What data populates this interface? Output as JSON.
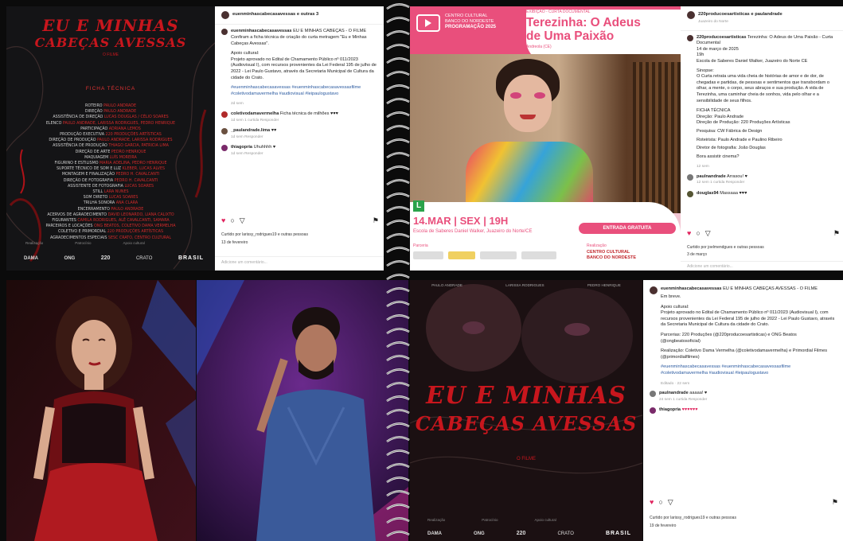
{
  "poster_tl": {
    "title_line1": "EU E MINHAS",
    "title_line2": "CABEÇAS AVESSAS",
    "subtitle": "O FILME",
    "section": "FICHA TÉCNICA",
    "credits": [
      {
        "role": "ROTEIRO",
        "name": "PAULO ANDRADE"
      },
      {
        "role": "DIREÇÃO",
        "name": "PAULO ANDRADE"
      },
      {
        "role": "ASSISTÊNCIA DE DIREÇÃO",
        "name": "LUCAS DOUGLAS / CÉLIO SOARES"
      },
      {
        "role": "ELENCO",
        "name": "PAULO ANDRADE, LARISSA RODRIGUES, PEDRO HENRIQUE"
      },
      {
        "role": "PARTICIPAÇÃO",
        "name": "ADRIANA LEMOS"
      },
      {
        "role": "PRODUÇÃO EXECUTIVA",
        "name": "220 PRODUÇÕES ARTÍSTICAS"
      },
      {
        "role": "DIREÇÃO DE PRODUÇÃO",
        "name": "PAULO ANDRADE, LARISSA RODRIGUES"
      },
      {
        "role": "ASSISTÊNCIA DE PRODUÇÃO",
        "name": "THIAGO GARCIA, PATRICIA LIMA"
      },
      {
        "role": "DIREÇÃO DE ARTE",
        "name": "PEDRO HENRIQUE"
      },
      {
        "role": "MAQUIAGEM",
        "name": "LUÍS MOREIRA"
      },
      {
        "role": "FIGURINO E ESTILISMO",
        "name": "MARIA ADELINA, PEDRO HENRIQUE"
      },
      {
        "role": "SUPORTE TÉCNICO DE SOM E LUZ",
        "name": "KLEBER, LUCAS ALVES"
      },
      {
        "role": "MONTAGEM E FINALIZAÇÃO",
        "name": "PEDRO H. CAVALCANTI"
      },
      {
        "role": "DIREÇÃO DE FOTOGRAFIA",
        "name": "PEDRO H. CAVALCANTI"
      },
      {
        "role": "ASSISTENTE DE FOTOGRAFIA",
        "name": "LUCAS SOARES"
      },
      {
        "role": "STILL",
        "name": "LARA NUNES"
      },
      {
        "role": "SOM DIRETO",
        "name": "LUCAS SOARES"
      },
      {
        "role": "TRILHA SONORA",
        "name": "ANA CLARA"
      },
      {
        "role": "ENCERRAMENTO",
        "name": "PAULO ANDRADE"
      },
      {
        "role": "ACERVOS DE AGRADECIMENTO",
        "name": "DAVID LEONARDO, LIANA CALIXTO"
      },
      {
        "role": "FIGURANTES",
        "name": "CAMILA RODRIGUES, ALÊ CAVALCANTI, SAMARA"
      },
      {
        "role": "PARCEIROS E LOCAÇÕES",
        "name": "ONG BEATOS, COLETIVO DAMA VERMELHA"
      },
      {
        "role": "COLETIVO E PRIMORDIAL",
        "name": "220 PRODUÇÕES ARTÍSTICAS"
      },
      {
        "role": "AGRADECIMENTOS ESPECIAIS",
        "name": "SESC CRATO, CENTRO CULTURAL"
      }
    ],
    "footer_labels": [
      "Realização",
      "Patrocínio",
      "Apoio cultural"
    ],
    "footer_logos": [
      "DAMA",
      "ONG",
      "220",
      "CRATO",
      "BRASIL"
    ]
  },
  "ig_top": {
    "header_user": "euenminhascabecasavessas e outras 3",
    "post_user": "euenminhascabecasavessas",
    "post_title": "EU E MINHAS CABEÇAS - O FILME",
    "para1": "Confiram a ficha técnica de criação do curta metragem \"Eu e Minhas Cabeças Avessas\".",
    "para2_title": "Apoio cultural:",
    "para2": "Projeto aprovado no Edital de Chamamento Público nº 011/2023 (Audiovisual I), com recursos provenientes da Lei Federal 195 de julho de 2022 - Lei Paulo Gustavo, através da Secretaria Municipal de Cultura da cidade do Crato.",
    "hashtags": "#euenminhascabecasavessas #euenminhascabecasavessasfilme #coletivodamavermelha #audiovisual #leipaulogustavo",
    "post_time": "2d sem",
    "comments": [
      {
        "user": "coletivodamavermelha",
        "text": "Ficha técnica de milhões ♥♥♥",
        "meta": "1d sem   1 curtida   Responder"
      },
      {
        "user": "_paulandrade.lima",
        "text": "♥♥",
        "meta": "1d sem   Responder"
      },
      {
        "user": "thiagopria",
        "text": "Uhuhhhh ♥",
        "meta": "1d sem   Responder"
      }
    ],
    "liked_by": "Curtido por larissy_rodrigues19 e outras pessoas",
    "date": "13 de fevereiro",
    "add_comment": "Adicione um comentário..."
  },
  "doc_poster": {
    "cc_name": "CENTRO CULTURAL",
    "cc_sub": "BANCO DO NORDESTE",
    "program": "PROGRAMAÇÃO 2025",
    "category": "EXIBIÇÃO - CURTA DOCUMENTAL",
    "title_line1": "Terezinha: O Adeus",
    "title_line2": "de Uma Paixão",
    "location_small": "Andreola (CE)",
    "rating": "L",
    "date": "14.MAR",
    "weekday": "SEX",
    "time": "19H",
    "venue": "Escola de Saberes Daniel Walker, Juazeiro do Norte/CE",
    "entry": "ENTRADA GRATUITA",
    "partner_label": "Parceria",
    "realization_label": "Realização",
    "realization_logo": "CENTRO CULTURAL BANCO DO NORDESTE"
  },
  "ig_doc": {
    "header_user": "220producoesartisticas e paulandrade",
    "header_sub": "Juazeiro do Norte",
    "post_user": "220producoesartisticas",
    "post_text": "Terezinha: O Adeus de Uma Paixão - Curta Documental",
    "lines": [
      "14 de março de 2025",
      "19h",
      "Escola de Saberes Daniel Walker, Juazeiro do Norte CE"
    ],
    "sinopse_title": "Sinopse:",
    "sinopse": "O Curta retrata uma vida cheia de histórias de amor e de dor, de chegadas e partidas, de pessoas e sentimentos que transbordam o olhar, a mente, o corpo, seus abraços e sua produção. A vida de Terezinha, uma caminhar cheia de sonhos, vida pelo olhar e a sensibilidade de seus filhos.",
    "ficha_title": "FICHA TÉCNICA",
    "ficha": [
      "Direção: Paulo Andrade",
      "Direção de Produção: 220 Produções Artísticas",
      "Pesquisa: CW Fábrica de Design",
      "Roteirista: Paulo Andrade e Paulino Ribeiro",
      "Diretor de fotografia: João Douglas",
      "Bora assistir cinema?"
    ],
    "post_time": "12 sem",
    "comments": [
      {
        "user": "paulnandrade",
        "text": "Arrasou! ♥",
        "meta": "12 sem   1 curtida   Responder"
      },
      {
        "user": "douglas94",
        "text": "Massaaa ♥♥♥",
        "meta": "12 sem"
      }
    ],
    "liked_by": "Curtido por joelmendgues e outras pessoas",
    "date": "3 de março",
    "add_comment": "Adicione um comentário..."
  },
  "poster_b": {
    "top_names": [
      "PAULO ANDRADE",
      "LARISSA RODRIGUES",
      "PEDRO HENRIQUE"
    ],
    "title_line1": "EU E MINHAS",
    "title_line2": "CABEÇAS AVESSAS",
    "subtitle": "O FILME",
    "footer_labels": [
      "Realização",
      "Patrocínio",
      "Apoio cultural"
    ],
    "footer_logos": [
      "DAMA",
      "ONG",
      "220",
      "CRATO",
      "BRASIL"
    ]
  },
  "ig_b": {
    "post_user": "euenminhascabecasavessas",
    "post_title": "EU E MINHAS CABEÇAS AVESSAS - O FILME",
    "para0": "Em breve.",
    "para1_title": "Apoio cultural:",
    "para1": "Projeto aprovado no Edital de Chamamento Público nº 011/2023 (Audiovisual I), com recursos provenientes da Lei Federal 195 de julho de 2022 - Lei Paulo Gustavo, através da Secretaria Municipal de Cultura da cidade do Crato.",
    "para2": "Parcerias: 220 Produções (@220producoesartisticas) e ONG Beatos (@ongbeatosoficial)",
    "para3": "Realização: Coletivo Dama Vermelha (@coletivodamavermelha) e Primordial Filmes (@primordialfilmes)",
    "hashtags": "#euenminhascabecasavessas #euenminhascabecasavessasfilme #coletivodamavermelha #audiovisual #leipaulogustavo",
    "edit_meta": "Editado · 22 sem",
    "comments": [
      {
        "user": "paulnandrade",
        "text": "aaaaa! ♥",
        "meta": "24 sem   1 curtida   Responder"
      },
      {
        "user": "thiagopria",
        "text": "♥♥♥♥♥♥",
        "meta": ""
      }
    ],
    "liked_by": "Curtido por larissy_rodrigues19 e outras pessoas",
    "date": "19 de fevereiro"
  },
  "colors": {
    "red": "#c8161d",
    "pink": "#e94f7c",
    "ig_blue": "#2b5aa0",
    "heart": "#e0245e"
  },
  "icons": [
    "heart-icon",
    "comment-icon",
    "share-icon",
    "bookmark-icon",
    "avatar-icon"
  ]
}
